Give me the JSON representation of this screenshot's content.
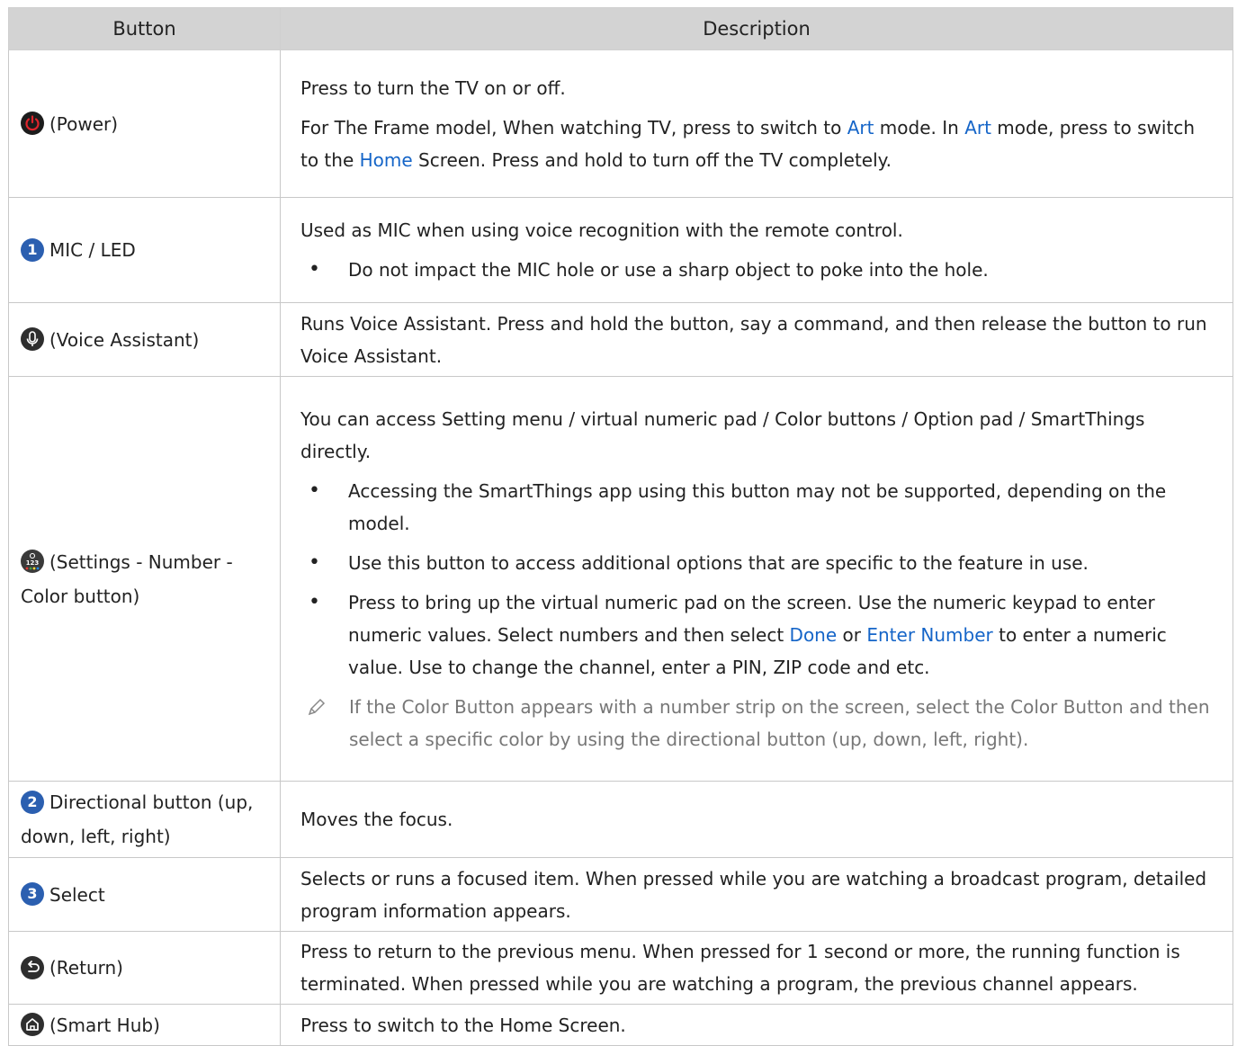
{
  "headers": {
    "button": "Button",
    "description": "Description"
  },
  "rows": {
    "power": {
      "label": "(Power)",
      "p1": "Press to turn the TV on or off.",
      "p2a": "For The Frame model, When watching TV, press to switch to ",
      "kw1": "Art",
      "p2b": " mode. In ",
      "kw2": "Art",
      "p2c": " mode, press to switch to the ",
      "kw3": "Home",
      "p2d": " Screen. Press and hold to turn off the TV completely."
    },
    "mic": {
      "num": "1",
      "label": "MIC / LED",
      "p1": "Used as MIC when using voice recognition with the remote control.",
      "b1": "Do not impact the MIC hole or use a sharp object to poke into the hole."
    },
    "voice": {
      "label": "(Voice Assistant)",
      "p1": "Runs Voice Assistant. Press and hold the button, say a command, and then release the button to run Voice Assistant."
    },
    "settings": {
      "label": "(Settings - Number - Color button)",
      "p1": "You can access Setting menu / virtual numeric pad / Color buttons / Option pad / SmartThings directly.",
      "b1": "Accessing the SmartThings app using this button may not be supported, depending on the model.",
      "b2": "Use this button to access additional options that are specific to the feature in use.",
      "b3a": "Press to bring up the virtual numeric pad on the screen. Use the numeric keypad to enter numeric values. Select numbers and then select ",
      "b3kw1": "Done",
      "b3b": " or ",
      "b3kw2": "Enter Number",
      "b3c": " to enter a numeric value. Use to change the channel, enter a PIN, ZIP code and etc.",
      "note": "If the Color Button appears with a number strip on the screen, select the Color Button and then select a specific color by using the directional button (up, down, left, right)."
    },
    "directional": {
      "num": "2",
      "label": "Directional button (up, down, left, right)",
      "p1": "Moves the focus."
    },
    "select": {
      "num": "3",
      "label": "Select",
      "p1": "Selects or runs a focused item. When pressed while you are watching a broadcast program, detailed program information appears."
    },
    "return": {
      "label": "(Return)",
      "p1": "Press to return to the previous menu. When pressed for 1 second or more, the running function is terminated. When pressed while you are watching a program, the previous channel appears."
    },
    "smarthub": {
      "label": "(Smart Hub)",
      "p1": "Press to switch to the Home Screen."
    }
  },
  "icons": {
    "power": "power-icon",
    "voice": "microphone-icon",
    "settings": "settings-number-color-icon",
    "return": "return-icon",
    "smarthub": "home-icon",
    "note": "pencil-icon"
  },
  "colors": {
    "keyword": "#1565c8",
    "number_badge": "#2b5fb0",
    "power_red": "#e0242c",
    "note_text": "#777777",
    "header_bg": "#d3d3d3"
  }
}
